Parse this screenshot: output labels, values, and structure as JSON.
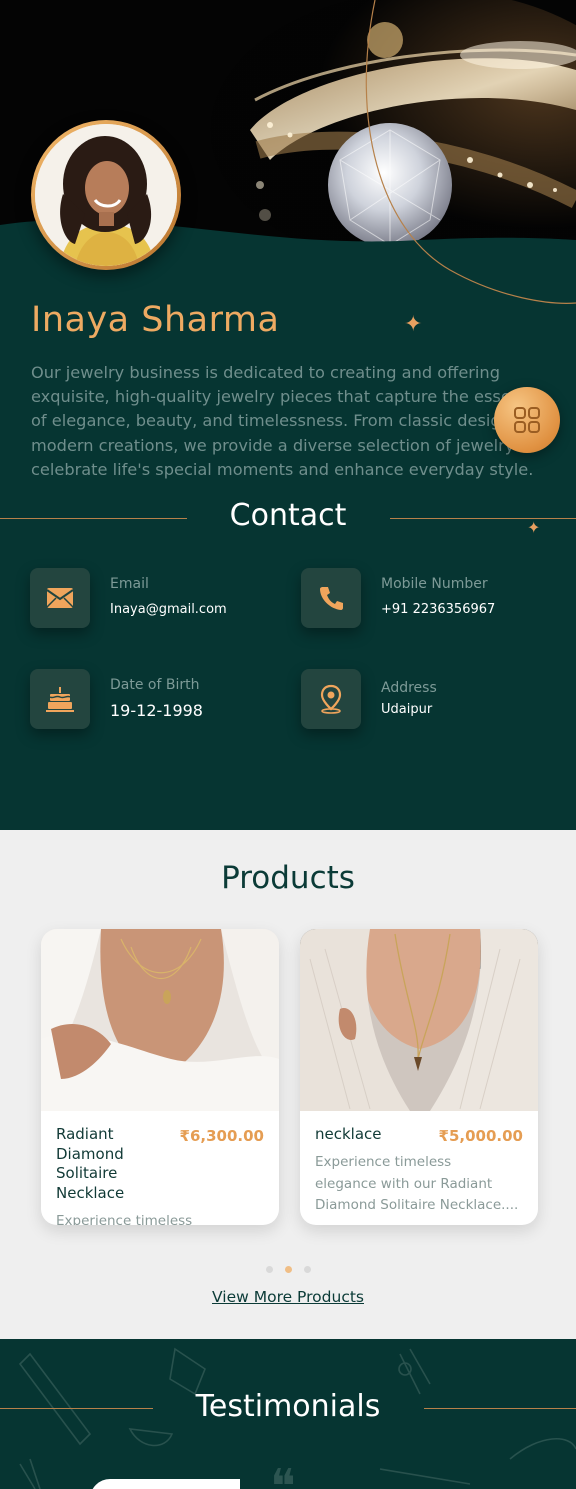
{
  "profile": {
    "name": "Inaya Sharma",
    "bio_lines": [
      "Our jewelry business is dedicated to creating and offering",
      "exquisite, high-quality jewelry pieces that capture the esse",
      "of elegance, beauty, and timelessness. From classic desig",
      "modern creations, we provide a diverse selection of jewelry t",
      "celebrate life's special moments and enhance everyday style."
    ]
  },
  "contact": {
    "heading": "Contact",
    "items": [
      {
        "label": "Email",
        "value": "Inaya@gmail.com",
        "icon": "envelope-icon"
      },
      {
        "label": "Mobile Number",
        "value": "+91 2236356967",
        "icon": "phone-icon"
      },
      {
        "label": "Date of Birth",
        "value": "19-12-1998",
        "icon": "cake-icon"
      },
      {
        "label": "Address",
        "value": "Udaipur",
        "icon": "location-pin-icon"
      }
    ]
  },
  "products": {
    "heading": "Products",
    "items": [
      {
        "title_lines": [
          "Radiant",
          "Diamond",
          "Solitaire",
          "Necklace"
        ],
        "price": "₹6,300.00",
        "desc_lines": [
          "Experience timeless"
        ]
      },
      {
        "title_lines": [
          "necklace"
        ],
        "price": "₹5,000.00",
        "desc_lines": [
          "Experience timeless",
          "elegance with our Radiant",
          "Diamond Solitaire Necklace...."
        ]
      }
    ],
    "view_more": "View More Products",
    "carousel_page": 2,
    "carousel_pages": 3
  },
  "testimonials": {
    "heading": "Testimonials"
  },
  "colors": {
    "teal_bg": "#063532",
    "gold": "#eeaa62",
    "light_bg": "#efefef"
  }
}
